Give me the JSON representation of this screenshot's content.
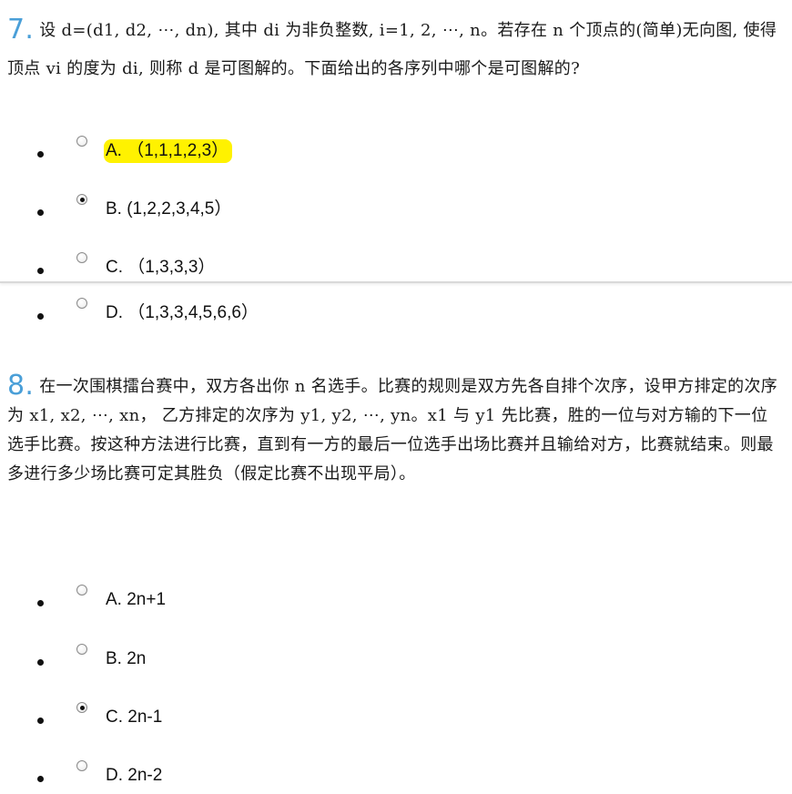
{
  "q7": {
    "number": "7.",
    "text": "设 d=(d1, d2, ⋯, dn), 其中 di 为非负整数, i=1, 2, ⋯, n。若存在 n 个顶点的(简单)无向图, 使得顶点 vi 的度为 di, 则称 d 是可图解的。下面给出的各序列中哪个是可图解的?",
    "options": [
      {
        "label": "A. （1,1,1,2,3）",
        "checked": false,
        "highlighted": true
      },
      {
        "label": "B. (1,2,2,3,4,5）",
        "checked": true,
        "highlighted": false
      },
      {
        "label": "C. （1,3,3,3）",
        "checked": false,
        "highlighted": false
      },
      {
        "label": "D. （1,3,3,4,5,6,6）",
        "checked": false,
        "highlighted": false
      }
    ]
  },
  "q8": {
    "number": "8.",
    "text": "在一次围棋擂台赛中，双方各出你 n 名选手。比赛的规则是双方先各自排个次序，设甲方排定的次序为 x1, x2, ⋯, xn， 乙方排定的次序为 y1, y2, ⋯, yn。x1 与 y1 先比赛，胜的一位与对方输的下一位选手比赛。按这种方法进行比赛，直到有一方的最后一位选手出场比赛并且输给对方，比赛就结束。则最多进行多少场比赛可定其胜负（假定比赛不出现平局）。",
    "options": [
      {
        "label": "A. 2n+1",
        "checked": false,
        "highlighted": false
      },
      {
        "label": "B. 2n",
        "checked": false,
        "highlighted": false
      },
      {
        "label": "C. 2n-1",
        "checked": true,
        "highlighted": false
      },
      {
        "label": "D. 2n-2",
        "checked": false,
        "highlighted": false
      }
    ]
  },
  "colors": {
    "question_number": "#4a9fd8",
    "highlight": "#fff200"
  },
  "icons": {
    "bullet": "bullet-icon",
    "radio": "radio-button"
  }
}
